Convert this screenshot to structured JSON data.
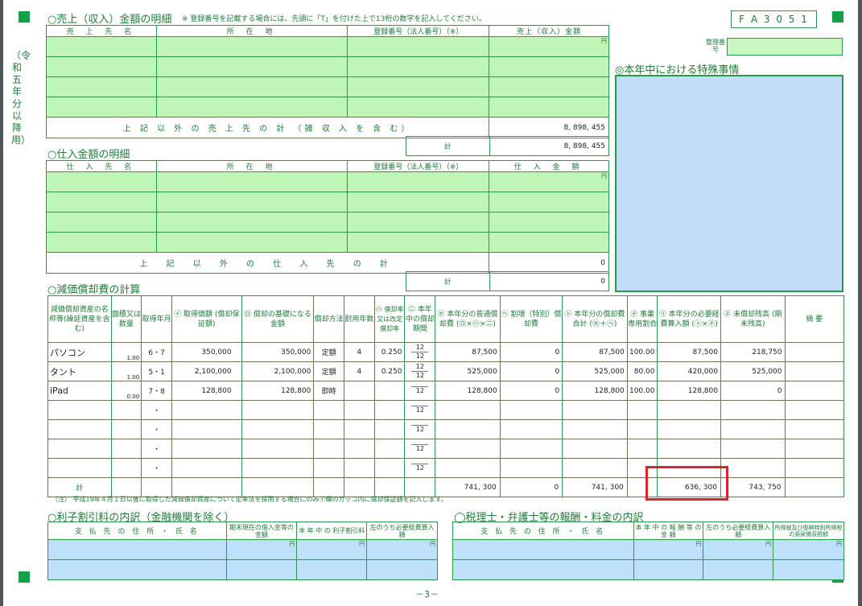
{
  "form_code": "F A 3 0 5 1",
  "era_label": "（令和五年分以降用）",
  "seiri_label": "整理番号",
  "sales": {
    "title": "○売上（収入）金額の明細",
    "note": "※ 登録番号を記載する場合には、先頭に「T」を付けた上で13桁の数字を記入してください。",
    "headers": [
      "売 上 先 名",
      "所 在 地",
      "登録番号（法人番号）（※）",
      "売上（収入）金額"
    ],
    "yen": "円",
    "other_label": "上 記 以 外 の 売 上 先 の 計 （雑 収 入 を 含 む）",
    "other_value": "8, 898, 455",
    "total_label": "計",
    "total_value": "8, 898, 455"
  },
  "special": {
    "title": "◎本年中における特殊事情"
  },
  "purchases": {
    "title": "○仕入金額の明細",
    "headers": [
      "仕 入 先 名",
      "所 在 地",
      "登録番号（法人番号）（※）",
      "仕 入 金 額"
    ],
    "yen": "円",
    "other_label": "上 記 以 外 の 仕 入 先 の 計",
    "other_value": "0",
    "total_label": "計",
    "total_value": "0"
  },
  "depreciation": {
    "title": "○減価償却費の計算",
    "headers": [
      "減価償却資産の名称等(繰延資産を含む)",
      "面積又は数量",
      "取得年月",
      "㋑ 取得価額 (償却保証額)",
      "㋺ 償却の基礎になる金額",
      "償却方法",
      "耐用年数",
      "㋩ 償却率又は改定償却率",
      "㊁ 本年中の償却期間",
      "㋭ 本年分の普通償却費 (㋺×㋩×㊁)",
      "㋬ 割増（特別）償却費",
      "㋣ 本年分の償却費合計 (㋭＋㋬)",
      "㋠ 事業専用割合",
      "㋷ 本年分の必要経費算入額 (㋣×㋠)",
      "㋦ 未償却残高 (期末残高)",
      "摘 要"
    ],
    "rows": [
      {
        "name": "パソコン",
        "qty": "1.00",
        "date": "6・7",
        "cost": "350,000",
        "base": "350,000",
        "method": "定額",
        "life": "4",
        "rate": "0.250",
        "period": "12",
        "period_den": "12",
        "ordinary": "87,500",
        "extra": "0",
        "total": "87,500",
        "ratio": "100.00",
        "expense": "87,500",
        "remaining": "218,750"
      },
      {
        "name": "タント",
        "qty": "1.00",
        "date": "5・1",
        "cost": "2,100,000",
        "base": "2,100,000",
        "method": "定額",
        "life": "4",
        "rate": "0.250",
        "period": "12",
        "period_den": "12",
        "ordinary": "525,000",
        "extra": "0",
        "total": "525,000",
        "ratio": "80.00",
        "expense": "420,000",
        "remaining": "525,000"
      },
      {
        "name": "iPad",
        "qty": "0.00",
        "date": "7・8",
        "cost": "128,800",
        "base": "128,800",
        "method": "即時",
        "life": "",
        "rate": "",
        "period": "",
        "period_den": "12",
        "ordinary": "128,800",
        "extra": "0",
        "total": "128,800",
        "ratio": "100.00",
        "expense": "128,800",
        "remaining": "0"
      },
      {
        "name": "",
        "qty": "",
        "date": "・",
        "cost": "",
        "base": "",
        "method": "",
        "life": "",
        "rate": "",
        "period": "",
        "period_den": "12",
        "ordinary": "",
        "extra": "",
        "total": "",
        "ratio": "",
        "expense": "",
        "remaining": ""
      },
      {
        "name": "",
        "qty": "",
        "date": "・",
        "cost": "",
        "base": "",
        "method": "",
        "life": "",
        "rate": "",
        "period": "",
        "period_den": "12",
        "ordinary": "",
        "extra": "",
        "total": "",
        "ratio": "",
        "expense": "",
        "remaining": ""
      },
      {
        "name": "",
        "qty": "",
        "date": "・",
        "cost": "",
        "base": "",
        "method": "",
        "life": "",
        "rate": "",
        "period": "",
        "period_den": "12",
        "ordinary": "",
        "extra": "",
        "total": "",
        "ratio": "",
        "expense": "",
        "remaining": ""
      },
      {
        "name": "",
        "qty": "",
        "date": "・",
        "cost": "",
        "base": "",
        "method": "",
        "life": "",
        "rate": "",
        "period": "",
        "period_den": "12",
        "ordinary": "",
        "extra": "",
        "total": "",
        "ratio": "",
        "expense": "",
        "remaining": ""
      }
    ],
    "total_label": "計",
    "total_ordinary": "741, 300",
    "total_extra": "0",
    "total_sum": "741, 300",
    "total_expense": "636, 300",
    "total_remaining": "743, 750",
    "note": "（注） 平成19年４月１日以後に取得した減価償却資産について定率法を採用する場合にのみ㋑欄のカッコ内に償却保証額を記入します。"
  },
  "interest": {
    "title": "○利子割引料の内訳（金融機関を除く）",
    "headers": [
      "支 払 先 の 住 所 ・ 氏 名",
      "期末現在の借入金等の金額",
      "本 年 中 の 利子割引料",
      "左のうち必要経費算入額"
    ],
    "yen": "円"
  },
  "fees": {
    "title": "◯税理士・弁護士等の報酬・料金の内訳",
    "headers": [
      "支 払 先 の 住 所 ・ 氏 名",
      "本 年 中 の 報 酬 等 の 金 額",
      "左のうち必要経費算入額",
      "所得税及び復興特別所得税の源泉徴収税額"
    ],
    "yen": "円"
  },
  "page_number": "－3－"
}
